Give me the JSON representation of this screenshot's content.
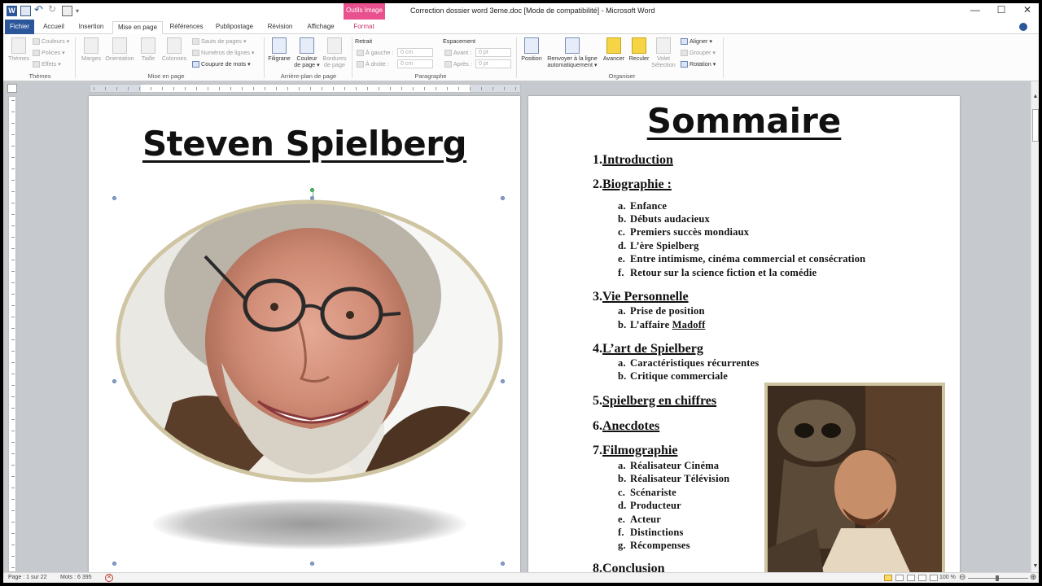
{
  "window": {
    "title": "Correction dossier word 3eme.doc [Mode de compatibilité]  -  Microsoft Word",
    "context_tab_group": "Outils Image",
    "controls": [
      "—",
      "☐",
      "✕"
    ]
  },
  "tabs": [
    {
      "label": "Fichier"
    },
    {
      "label": "Accueil"
    },
    {
      "label": "Insertion"
    },
    {
      "label": "Mise en page"
    },
    {
      "label": "Références"
    },
    {
      "label": "Publipostage"
    },
    {
      "label": "Révision"
    },
    {
      "label": "Affichage"
    },
    {
      "label": "Format"
    }
  ],
  "ribbon": {
    "themes": {
      "big": "Thèmes",
      "couleurs": "Couleurs",
      "polices": "Polices",
      "effets": "Effets",
      "group": "Thèmes"
    },
    "mise_en_page": {
      "marges": "Marges",
      "orientation": "Orientation",
      "taille": "Taille",
      "colonnes": "Colonnes",
      "sauts": "Sauts de pages",
      "numeros": "Numéros de lignes",
      "coupure": "Coupure de mots",
      "group": "Mise en page"
    },
    "arriere_plan": {
      "filigrane": "Filigrane",
      "couleur_line1": "Couleur",
      "couleur_line2": "de page",
      "bordures_line1": "Bordures",
      "bordures_line2": "de page",
      "group": "Arrière-plan de page"
    },
    "paragraphe": {
      "retrait": "Retrait",
      "espacement": "Espacement",
      "gauche_label": "À gauche :",
      "gauche_value": "0 cm",
      "droite_label": "À droite :",
      "droite_value": "0 cm",
      "avant_label": "Avant :",
      "avant_value": "0 pt",
      "apres_label": "Après :",
      "apres_value": "0 pt",
      "group": "Paragraphe"
    },
    "organiser": {
      "position": "Position",
      "renvoyer_line1": "Renvoyer à la ligne",
      "renvoyer_line2": "automatiquement",
      "avancer": "Avancer",
      "reculer": "Reculer",
      "volet_line1": "Volet",
      "volet_line2": "Sélection",
      "aligner": "Aligner",
      "grouper": "Grouper",
      "rotation": "Rotation",
      "group": "Organiser"
    }
  },
  "page1": {
    "title": "Steven Spielberg"
  },
  "page2": {
    "title": "Sommaire",
    "sections": [
      {
        "num": "1.",
        "label": "Introduction"
      },
      {
        "num": "2.",
        "label": "Biographie :"
      },
      {
        "num": "3.",
        "label": "Vie Personnelle"
      },
      {
        "num": "4.",
        "label": "L’art de Spielberg"
      },
      {
        "num": "5.",
        "label": "Spielberg en chiffres"
      },
      {
        "num": "6.",
        "label": "Anecdotes"
      },
      {
        "num": "7.",
        "label": "Filmographie"
      },
      {
        "num": "8.",
        "label": "Conclusion"
      }
    ],
    "biographie": [
      {
        "l": "a.",
        "t": "Enfance"
      },
      {
        "l": "b.",
        "t": "Débuts audacieux"
      },
      {
        "l": "c.",
        "t": "Premiers succès mondiaux"
      },
      {
        "l": "d.",
        "t": "L’ère Spielberg"
      },
      {
        "l": "e.",
        "t": "Entre intimisme,  cinéma  commercial  et  consécration"
      },
      {
        "l": "f.",
        "t": "Retour  sur  la  science  fiction  et  la  comédie"
      }
    ],
    "vie": [
      {
        "l": "a.",
        "t": "Prise  de position"
      },
      {
        "l": "b.",
        "t": "L’affaire ",
        "u": "Madoff"
      }
    ],
    "art": [
      {
        "l": "a.",
        "t": "Caractéristiques  récurrentes"
      },
      {
        "l": "b.",
        "t": "Critique  commerciale"
      }
    ],
    "filmo": [
      {
        "l": "a.",
        "t": "Réalisateur  Cinéma"
      },
      {
        "l": "b.",
        "t": "Réalisateur  Télévision"
      },
      {
        "l": "c.",
        "t": "Scénariste"
      },
      {
        "l": "d.",
        "t": "Producteur"
      },
      {
        "l": "e.",
        "t": "Acteur"
      },
      {
        "l": "f.",
        "t": "Distinctions"
      },
      {
        "l": "g.",
        "t": "Récompenses"
      }
    ]
  },
  "status": {
    "page": "Page : 1 sur 22",
    "words": "Mots : 6 395",
    "zoom": "100 %"
  },
  "colors": {
    "word_blue": "#2b579a",
    "context_pink": "#e8508e",
    "frame_gold": "#cfc5a3"
  }
}
